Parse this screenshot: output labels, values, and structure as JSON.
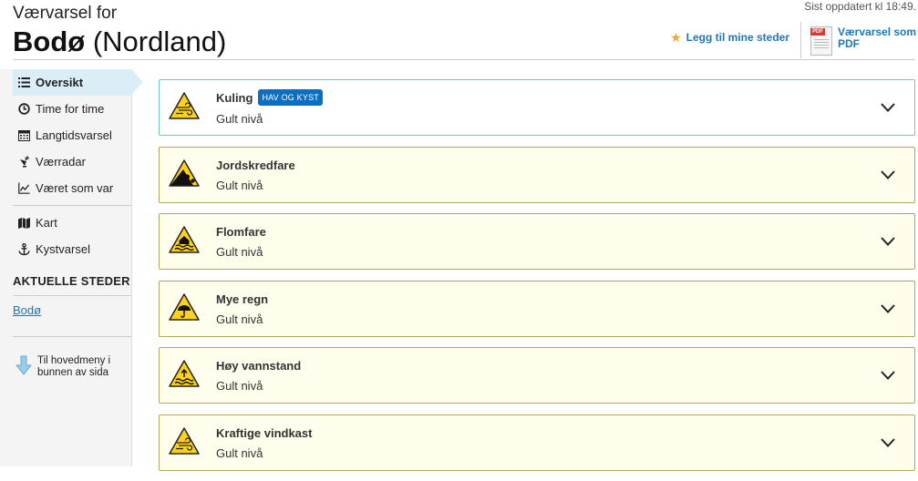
{
  "header": {
    "last_updated": "Sist oppdatert kl 18:49.",
    "subtitle": "Værvarsel for",
    "place_bold": "Bodø",
    "place_region": "(Nordland)",
    "add_favorite": "Legg til mine steder",
    "pdf_label": "Værvarsel som PDF",
    "pdf_tag": "PDF"
  },
  "sidebar": {
    "nav_top": [
      {
        "label": "Oversikt",
        "icon": "list-icon"
      },
      {
        "label": "Time for time",
        "icon": "clock-icon"
      },
      {
        "label": "Langtidsvarsel",
        "icon": "calendar-icon"
      },
      {
        "label": "Værradar",
        "icon": "radar-icon"
      },
      {
        "label": "Været som var",
        "icon": "chart-icon"
      }
    ],
    "nav_bottom": [
      {
        "label": "Kart",
        "icon": "map-icon"
      },
      {
        "label": "Kystvarsel",
        "icon": "anchor-icon"
      }
    ],
    "current_places_title": "AKTUELLE STEDER",
    "current_places": [
      "Bodø"
    ],
    "main_menu_link": "Til hovedmeny i bunnen av sida"
  },
  "warnings": [
    {
      "title": "Kuling",
      "badge": "HAV OG KYST",
      "level": "Gult nivå",
      "icon": "wind-warning-icon"
    },
    {
      "title": "Jordskredfare",
      "badge": "",
      "level": "Gult nivå",
      "icon": "landslide-warning-icon"
    },
    {
      "title": "Flomfare",
      "badge": "",
      "level": "Gult nivå",
      "icon": "flood-warning-icon"
    },
    {
      "title": "Mye regn",
      "badge": "",
      "level": "Gult nivå",
      "icon": "rain-warning-icon"
    },
    {
      "title": "Høy vannstand",
      "badge": "",
      "level": "Gult nivå",
      "icon": "high-water-warning-icon"
    },
    {
      "title": "Kraftige vindkast",
      "badge": "",
      "level": "Gult nivå",
      "icon": "gust-warning-icon"
    }
  ],
  "colors": {
    "link": "#1f78b4",
    "warning_yellow": "#ffd21a",
    "badge": "#0a6fc2",
    "active_nav": "#dbeef8"
  }
}
